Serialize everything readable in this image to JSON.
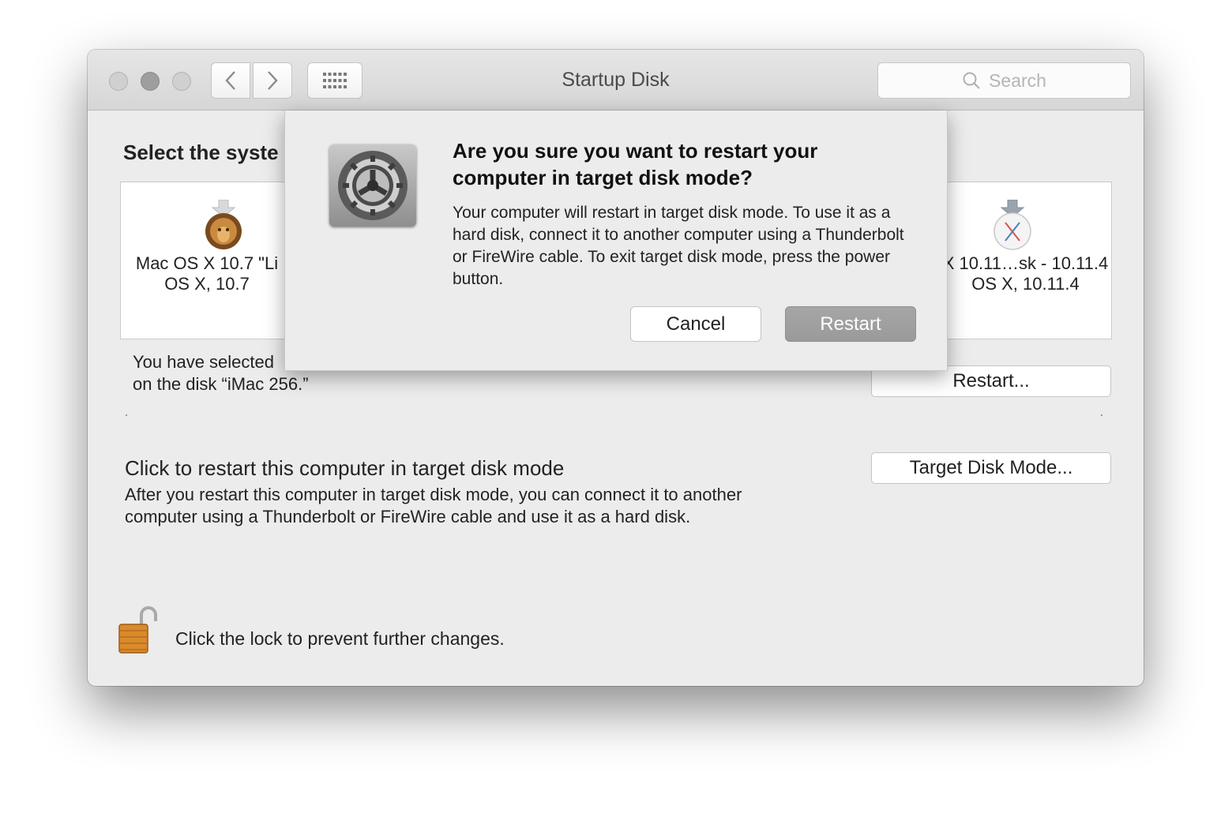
{
  "window": {
    "title": "Startup Disk",
    "search_placeholder": "Search"
  },
  "main": {
    "heading": "Select the syste",
    "disks": [
      {
        "name": "Mac OS X 10.7 \"Li",
        "version": "OS X, 10.7",
        "icon": "lion-icon"
      },
      {
        "name": "X 10.11…sk - 10.11.4",
        "version": "OS X, 10.11.4",
        "icon": "el-capitan-icon"
      }
    ],
    "selected_text_line1": "You have selected",
    "selected_text_line2": "on the disk “iMac 256.”",
    "restart_button": "Restart...",
    "target_disk": {
      "title": "Click to restart this computer in target disk mode",
      "description": "After you restart this computer in target disk mode, you can connect it to another computer using a Thunderbolt or FireWire cable and use it as a hard disk.",
      "button": "Target Disk Mode..."
    },
    "lock_text": "Click the lock to prevent further changes."
  },
  "dialog": {
    "title": "Are you sure you want to restart your computer in target disk mode?",
    "message": "Your computer will restart in target disk mode. To use it as a hard disk, connect it to another computer using a Thunderbolt or FireWire cable. To exit target disk mode, press the power button.",
    "cancel": "Cancel",
    "confirm": "Restart"
  }
}
